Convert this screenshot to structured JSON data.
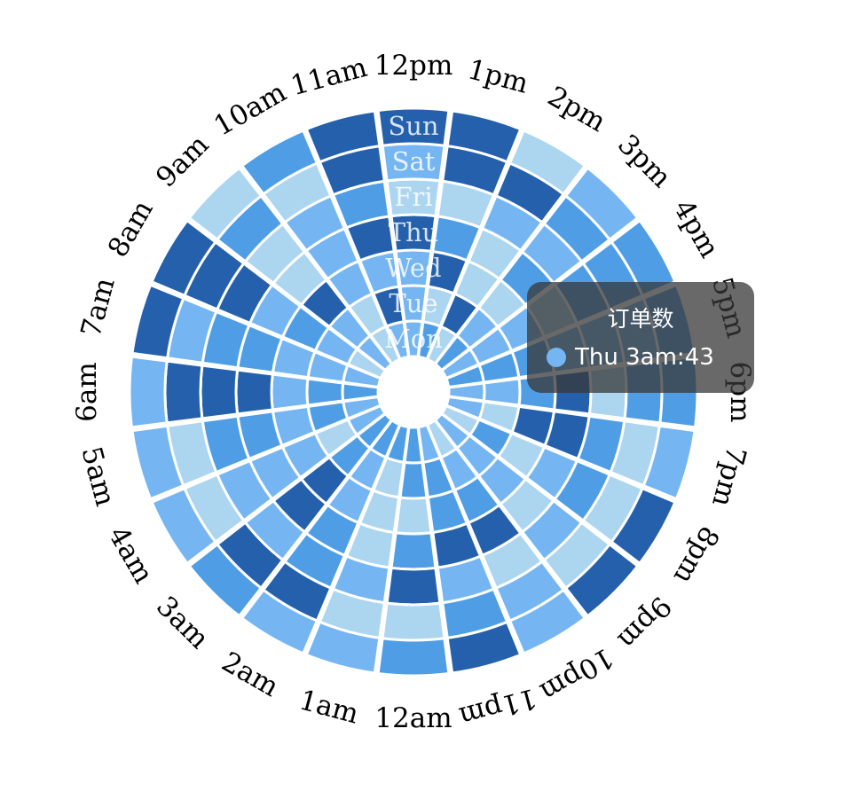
{
  "chart_data": {
    "type": "heatmap",
    "layout": "polar",
    "hours": [
      "12am",
      "1am",
      "2am",
      "3am",
      "4am",
      "5am",
      "6am",
      "7am",
      "8am",
      "9am",
      "10am",
      "11am",
      "12pm",
      "1pm",
      "2pm",
      "3pm",
      "4pm",
      "5pm",
      "6pm",
      "7pm",
      "8pm",
      "9pm",
      "10pm",
      "11pm"
    ],
    "days": [
      "Mon",
      "Tue",
      "Wed",
      "Thu",
      "Fri",
      "Sat",
      "Sun"
    ],
    "day_display": [
      "Mon",
      "Tue",
      "Wed",
      "Thu",
      "Fri",
      "Sat",
      "Sun"
    ],
    "levels": [
      [
        2,
        2,
        2,
        2,
        1,
        1,
        2,
        1,
        0,
        1,
        0,
        1,
        1,
        2,
        0,
        2,
        1,
        2,
        1,
        1,
        0,
        1,
        0,
        1
      ],
      [
        2,
        0,
        1,
        2,
        0,
        2,
        2,
        1,
        1,
        1,
        0,
        3,
        1,
        0,
        3,
        1,
        1,
        2,
        1,
        0,
        2,
        1,
        1,
        2
      ],
      [
        0,
        0,
        1,
        3,
        1,
        1,
        1,
        1,
        2,
        3,
        1,
        1,
        1,
        3,
        0,
        0,
        1,
        2,
        2,
        3,
        0,
        1,
        2,
        2
      ],
      [
        2,
        0,
        2,
        3,
        1,
        2,
        3,
        2,
        1,
        0,
        1,
        3,
        3,
        2,
        0,
        2,
        0,
        1,
        3,
        3,
        1,
        0,
        3,
        3
      ],
      [
        3,
        1,
        2,
        1,
        1,
        2,
        3,
        2,
        3,
        0,
        1,
        2,
        0,
        0,
        1,
        1,
        2,
        1,
        0,
        2,
        2,
        1,
        0,
        1
      ],
      [
        0,
        0,
        3,
        3,
        0,
        0,
        3,
        1,
        3,
        2,
        0,
        3,
        1,
        3,
        3,
        2,
        2,
        1,
        2,
        0,
        0,
        0,
        1,
        2
      ],
      [
        2,
        1,
        1,
        2,
        1,
        1,
        1,
        3,
        3,
        0,
        2,
        3,
        3,
        3,
        0,
        1,
        2,
        2,
        2,
        1,
        3,
        3,
        1,
        3
      ]
    ],
    "color_scale": [
      "#acd5f0",
      "#75b6f2",
      "#4f9ee5",
      "#2460ab"
    ]
  },
  "tooltip": {
    "title": "订单数",
    "text": "Thu 3am:43",
    "marker_color": "#75b6f2"
  }
}
